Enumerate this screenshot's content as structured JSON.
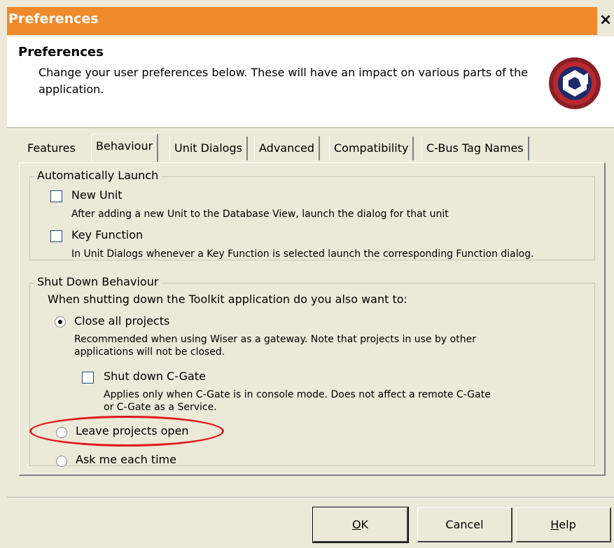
{
  "window": {
    "title": "Preferences",
    "close_glyph": "×",
    "title_bar_color": "#ee8a2b"
  },
  "header": {
    "title": "Preferences",
    "description": "Change your user preferences below.  These will have an impact on various parts of the application.",
    "logo_icon": "cbus-logo-icon"
  },
  "tabs": [
    {
      "label": "Features",
      "active": false
    },
    {
      "label": "Behaviour",
      "active": true
    },
    {
      "label": "Unit Dialogs",
      "active": false
    },
    {
      "label": "Advanced",
      "active": false
    },
    {
      "label": "Compatibility",
      "active": false
    },
    {
      "label": "C-Bus Tag Names",
      "active": false
    }
  ],
  "auto_launch": {
    "legend": "Automatically Launch",
    "options": [
      {
        "label": "New Unit",
        "checked": false,
        "description": "After adding a new Unit to the Database View, launch the dialog for that unit"
      },
      {
        "label": "Key Function",
        "checked": false,
        "description": "In Unit Dialogs whenever a Key Function is selected launch the corresponding Function dialog."
      }
    ]
  },
  "shutdown": {
    "legend": "Shut Down Behaviour",
    "prompt": "When shutting down the Toolkit application do you also want to:",
    "close_all": {
      "label": "Close all projects",
      "selected": true,
      "description": "Recommended when using Wiser as a gateway. Note that projects in use by other applications will not be closed."
    },
    "shut_down_cgate": {
      "label": "Shut down C-Gate",
      "checked": false,
      "description": "Applies only when C-Gate is in console mode. Does not affect a remote C-Gate or C-Gate as a Service."
    },
    "leave_open": {
      "label": "Leave projects open",
      "selected": false
    },
    "ask": {
      "label": "Ask me each time",
      "selected": false
    },
    "highlight_color": "#e0181f"
  },
  "buttons": {
    "ok_prefix": "",
    "ok_underlined": "O",
    "ok_suffix": "K",
    "cancel": "Cancel",
    "help_underlined": "H",
    "help_suffix": "elp"
  }
}
